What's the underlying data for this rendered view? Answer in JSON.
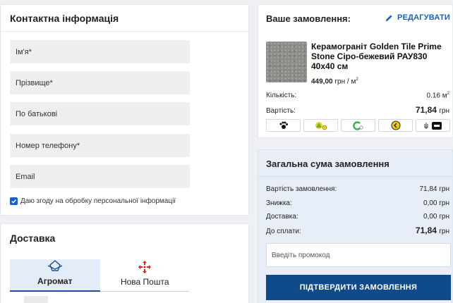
{
  "contact": {
    "title": "Контактна інформація",
    "fields": {
      "first_name": "Ім'я*",
      "last_name": "Прізвище*",
      "patronymic": "По батькові",
      "phone": "Номер телефону*",
      "email": "Email"
    },
    "consent_label": "Даю згоду на обробку персональної інформації",
    "consent_checked": true
  },
  "delivery": {
    "title": "Доставка",
    "tabs": [
      {
        "label": "Агромат",
        "icon": "agromat-logo-icon",
        "active": true
      },
      {
        "label": "Нова Пошта",
        "icon": "nova-poshta-logo-icon",
        "active": false
      }
    ]
  },
  "order": {
    "title": "Ваше замовлення:",
    "edit_label": "РЕДАГУВАТИ",
    "product": {
      "name": "Керамограніт Golden Tile Prime Stone Сіро-бежевий РАУ830 40х40 см",
      "price": "449,00",
      "price_unit": "грн / м",
      "price_unit_sup": "2"
    },
    "quantity_label": "Кількість:",
    "quantity_value": "0.16 м",
    "quantity_sup": "2",
    "cost_label": "Вартість:",
    "cost_value": "71,84",
    "cost_currency": "грн",
    "payment_icons": [
      "paw-pay-icon",
      "instalment-pay-icon",
      "green-pay-icon",
      "yellow-coin-pay-icon",
      "diia-icon"
    ]
  },
  "total": {
    "title": "Загальна сума замовлення",
    "rows": [
      {
        "label": "Вартість замовлення:",
        "value": "71,84 грн"
      },
      {
        "label": "Знижка:",
        "value": "0,00 грн"
      },
      {
        "label": "Доставка:",
        "value": "0,00 грн"
      }
    ],
    "due_label": "До сплати:",
    "due_value": "71,84",
    "due_currency": "грн",
    "promo_placeholder": "Введіть промокод",
    "confirm_label": "ПІДТВЕРДИТИ ЗАМОВЛЕННЯ"
  },
  "colors": {
    "accent": "#1a5fc6",
    "confirm": "#0f4a8a",
    "total_bg": "#e8eef7",
    "input_bg": "#efefef"
  }
}
